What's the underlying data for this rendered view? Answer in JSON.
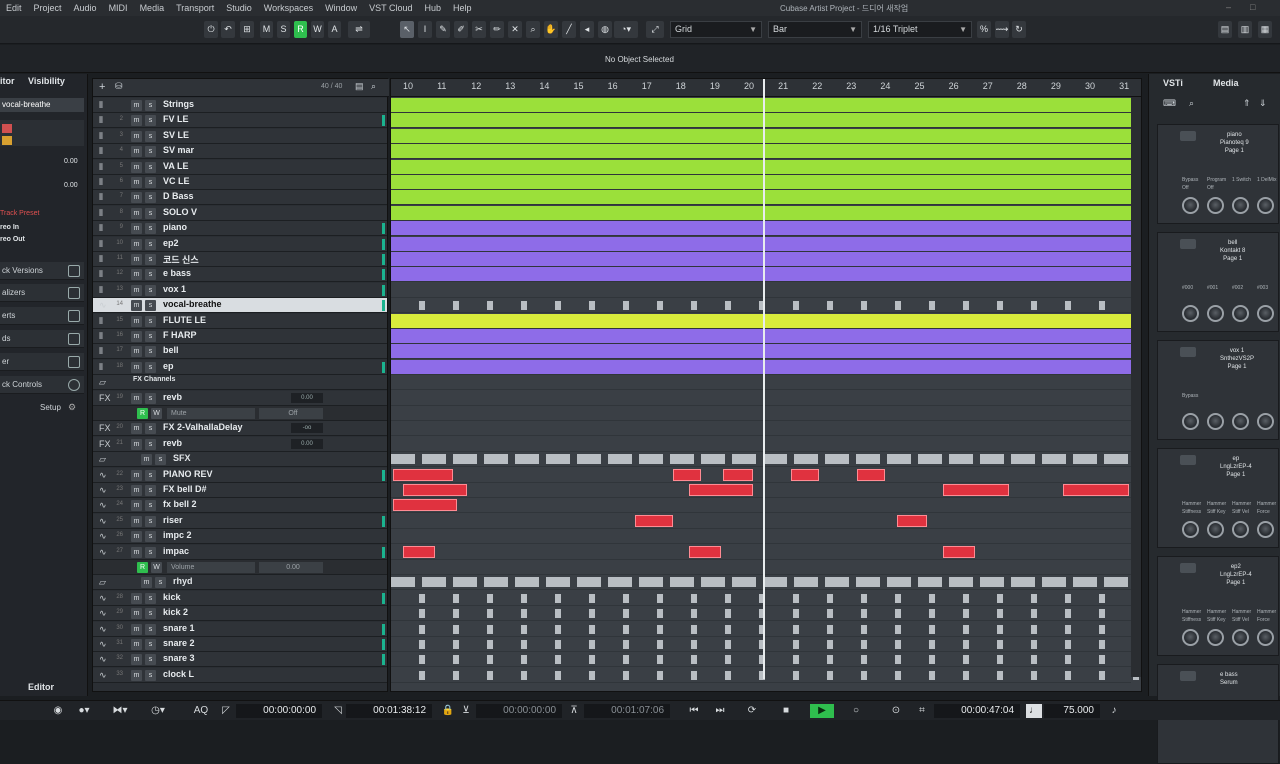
{
  "menu": [
    "Edit",
    "Project",
    "Audio",
    "MIDI",
    "Media",
    "Transport",
    "Studio",
    "Workspaces",
    "Window",
    "VST Cloud",
    "Hub",
    "Help"
  ],
  "window_title": "Cubase Artist Project - 드디어 새작업",
  "toolbar": {
    "m": "M",
    "s": "S",
    "r": "R",
    "w": "W",
    "a": "A",
    "grid_label": "Grid",
    "bar_label": "Bar",
    "quant_label": "1/16 Triplet"
  },
  "infoline": {
    "status": "No Object Selected"
  },
  "inspector": {
    "tab_inspector": "itor",
    "tab_visibility": "Visibility",
    "track_name": "vocal-breathe",
    "val1": "0.00",
    "val2": "0.00",
    "track_preset": "Track Preset",
    "stereo_in": "reo In",
    "stereo_out": "reo Out",
    "sections": [
      "ck Versions",
      "alizers",
      "erts",
      "ds",
      "er",
      "ck Controls"
    ],
    "setup": "Setup",
    "bottom_tab": "Editor"
  },
  "tracklist": {
    "counter": "40 / 40",
    "tracks": [
      {
        "n": "",
        "name": "Strings",
        "type": "inst"
      },
      {
        "n": "2",
        "name": "FV LE",
        "type": "inst",
        "meter": true
      },
      {
        "n": "3",
        "name": "SV LE",
        "type": "inst"
      },
      {
        "n": "4",
        "name": "SV mar",
        "type": "inst"
      },
      {
        "n": "5",
        "name": "VA LE",
        "type": "inst"
      },
      {
        "n": "6",
        "name": "VC LE",
        "type": "inst"
      },
      {
        "n": "7",
        "name": "D Bass",
        "type": "inst"
      },
      {
        "n": "8",
        "name": "SOLO V",
        "type": "inst"
      },
      {
        "n": "9",
        "name": "piano",
        "type": "inst",
        "meter": true
      },
      {
        "n": "10",
        "name": "ep2",
        "type": "inst",
        "meter": true
      },
      {
        "n": "11",
        "name": "코드 신스",
        "type": "inst",
        "meter": true
      },
      {
        "n": "12",
        "name": "e bass",
        "type": "inst",
        "meter": true
      },
      {
        "n": "13",
        "name": "vox 1",
        "type": "inst",
        "meter": true
      },
      {
        "n": "14",
        "name": "vocal-breathe",
        "type": "audio",
        "selected": true,
        "meter": true
      },
      {
        "n": "15",
        "name": "FLUTE LE",
        "type": "inst"
      },
      {
        "n": "16",
        "name": "F HARP",
        "type": "inst"
      },
      {
        "n": "17",
        "name": "bell",
        "type": "inst"
      },
      {
        "n": "18",
        "name": "ep",
        "type": "inst",
        "meter": true
      },
      {
        "n": "",
        "name": "FX Channels",
        "type": "folder"
      },
      {
        "n": "19",
        "name": "revb",
        "type": "fx",
        "val": "0.00"
      },
      {
        "n": "",
        "name": "Mute",
        "type": "sub",
        "val": "Off"
      },
      {
        "n": "20",
        "name": "FX 2-ValhallaDelay",
        "type": "fx",
        "val": "-oo"
      },
      {
        "n": "21",
        "name": "revb",
        "type": "fx",
        "val": "0.00"
      },
      {
        "n": "",
        "name": "SFX",
        "type": "folder2"
      },
      {
        "n": "22",
        "name": "PIANO REV",
        "type": "audio",
        "meter": true
      },
      {
        "n": "23",
        "name": "FX bell D#",
        "type": "audio"
      },
      {
        "n": "24",
        "name": "fx bell 2",
        "type": "audio"
      },
      {
        "n": "25",
        "name": "riser",
        "type": "audio",
        "meter": true
      },
      {
        "n": "26",
        "name": "impc 2",
        "type": "audio"
      },
      {
        "n": "27",
        "name": "impac",
        "type": "audio",
        "meter": true
      },
      {
        "n": "",
        "name": "Volume",
        "type": "sub",
        "val": "0.00"
      },
      {
        "n": "",
        "name": "rhyd",
        "type": "folder2"
      },
      {
        "n": "28",
        "name": "kick",
        "type": "audio",
        "meter": true
      },
      {
        "n": "29",
        "name": "kick 2",
        "type": "audio"
      },
      {
        "n": "30",
        "name": "snare 1",
        "type": "audio",
        "meter": true
      },
      {
        "n": "31",
        "name": "snare 2",
        "type": "audio",
        "meter": true
      },
      {
        "n": "32",
        "name": "snare 3",
        "type": "audio",
        "meter": true
      },
      {
        "n": "33",
        "name": "clock L",
        "type": "audio"
      }
    ]
  },
  "ruler": [
    "10",
    "11",
    "12",
    "13",
    "14",
    "15",
    "16",
    "17",
    "18",
    "19",
    "20",
    "21",
    "22",
    "23",
    "24",
    "25",
    "26",
    "27",
    "28",
    "29",
    "30",
    "31"
  ],
  "vsti": {
    "tab_vsti": "VSTi",
    "tab_media": "Media",
    "slots": [
      {
        "num": "8",
        "name": "piano",
        "plugin": "Pianoteq 9",
        "page": "Page 1",
        "params": [
          "Bypass",
          "Program",
          "1 Switch",
          "1 DelMix"
        ],
        "extra": [
          "Off",
          "Off"
        ]
      },
      {
        "num": "9",
        "name": "bell",
        "plugin": "Kontakt 8",
        "page": "Page 1",
        "params": [
          "#000",
          "#001",
          "#002",
          "#003"
        ],
        "extra": []
      },
      {
        "num": "10",
        "name": "vox 1",
        "plugin": "SnthezVS2P",
        "page": "Page 1",
        "params": [
          "Bypass"
        ],
        "extra": []
      },
      {
        "num": "11",
        "name": "ep",
        "plugin": "LngLzrEP-4",
        "page": "Page 1",
        "params": [
          "Hammer",
          "Hammer",
          "Hammer",
          "Hammer"
        ],
        "extra": [
          "Stiffness",
          "Stiff Key",
          "Stiff Vel",
          "Force"
        ]
      },
      {
        "num": "12",
        "name": "ep2",
        "plugin": "LngLzrEP-4",
        "page": "Page 1",
        "params": [
          "Hammer",
          "Hammer",
          "Hammer",
          "Hammer"
        ],
        "extra": [
          "Stiffness",
          "Stiff Key",
          "Stiff Vel",
          "Force"
        ]
      },
      {
        "num": "13",
        "name": "e bass",
        "plugin": "Serum",
        "page": "",
        "params": [],
        "extra": []
      }
    ]
  },
  "transport": {
    "aq": "AQ",
    "tc_left": "00:00:00:00",
    "tc_right_locator": "00:01:38:12",
    "tc_left2": "00:00:00:00",
    "tc_right2": "00:01:07:06",
    "position": "00:00:47:04",
    "tempo": "75.000"
  }
}
